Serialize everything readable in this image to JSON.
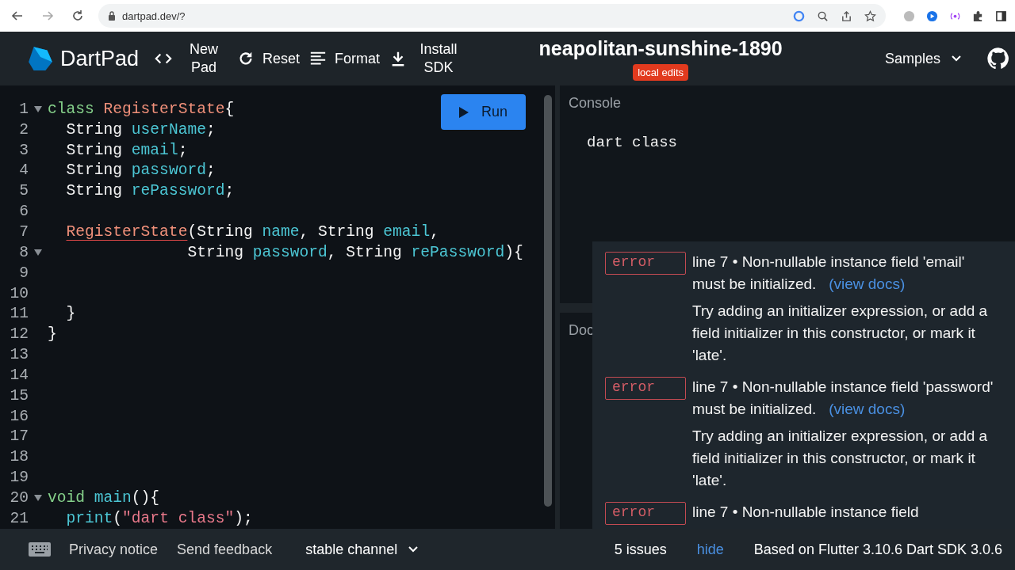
{
  "browser": {
    "url": "dartpad.dev/?"
  },
  "header": {
    "logo": "DartPad",
    "buttons": [
      {
        "kind": "code",
        "label": "New Pad"
      },
      {
        "kind": "refresh",
        "label": "Reset"
      },
      {
        "kind": "format",
        "label": "Format"
      },
      {
        "kind": "download",
        "label": "Install SDK"
      }
    ],
    "title": "neapolitan-sunshine-1890",
    "badge": "local edits",
    "samples": "Samples"
  },
  "editor": {
    "run": "Run",
    "lines": [
      {
        "number": "1",
        "fold": true,
        "tokens": [
          {
            "kind": "keyword",
            "text": "class "
          },
          {
            "kind": "class",
            "text": "RegisterState"
          },
          {
            "kind": "plain",
            "text": "{"
          }
        ]
      },
      {
        "number": "2",
        "fold": false,
        "tokens": [
          {
            "kind": "plain",
            "text": "  String "
          },
          {
            "kind": "ident",
            "text": "userName"
          },
          {
            "kind": "plain",
            "text": ";"
          }
        ]
      },
      {
        "number": "3",
        "fold": false,
        "tokens": [
          {
            "kind": "plain",
            "text": "  String "
          },
          {
            "kind": "ident",
            "text": "email"
          },
          {
            "kind": "plain",
            "text": ";"
          }
        ]
      },
      {
        "number": "4",
        "fold": false,
        "tokens": [
          {
            "kind": "plain",
            "text": "  String "
          },
          {
            "kind": "ident",
            "text": "password"
          },
          {
            "kind": "plain",
            "text": ";"
          }
        ]
      },
      {
        "number": "5",
        "fold": false,
        "tokens": [
          {
            "kind": "plain",
            "text": "  String "
          },
          {
            "kind": "ident",
            "text": "rePassword"
          },
          {
            "kind": "plain",
            "text": ";"
          }
        ]
      },
      {
        "number": "6",
        "fold": false
      },
      {
        "number": "7",
        "fold": false,
        "tokens": [
          {
            "kind": "error",
            "text": "  RegisterState"
          },
          {
            "kind": "plain",
            "text": "(String "
          },
          {
            "kind": "ident",
            "text": "name"
          },
          {
            "kind": "plain",
            "text": ", String "
          },
          {
            "kind": "ident",
            "text": "email"
          },
          {
            "kind": "plain",
            "text": ","
          }
        ]
      },
      {
        "number": "8",
        "fold": true,
        "tokens": [
          {
            "kind": "plain",
            "text": "               String "
          },
          {
            "kind": "ident",
            "text": "password"
          },
          {
            "kind": "plain",
            "text": ", String "
          },
          {
            "kind": "ident",
            "text": "rePassword"
          },
          {
            "kind": "plain",
            "text": "){"
          }
        ]
      },
      {
        "number": "9",
        "fold": false
      },
      {
        "number": "10",
        "fold": false
      },
      {
        "number": "11",
        "fold": false,
        "tokens": [
          {
            "kind": "plain",
            "text": "  }"
          }
        ]
      },
      {
        "number": "12",
        "fold": false,
        "tokens": [
          {
            "kind": "plain",
            "text": "}"
          }
        ]
      },
      {
        "number": "13",
        "fold": false
      },
      {
        "number": "14",
        "fold": false
      },
      {
        "number": "15",
        "fold": false
      },
      {
        "number": "16",
        "fold": false
      },
      {
        "number": "17",
        "fold": false
      },
      {
        "number": "18",
        "fold": false
      },
      {
        "number": "19",
        "fold": false
      },
      {
        "number": "20",
        "fold": true,
        "tokens": [
          {
            "kind": "keyword",
            "text": "void "
          },
          {
            "kind": "ident",
            "text": "main"
          },
          {
            "kind": "plain",
            "text": "(){"
          }
        ]
      },
      {
        "number": "21",
        "fold": false,
        "tokens": [
          {
            "kind": "ident",
            "text": "  print"
          },
          {
            "kind": "plain",
            "text": "("
          },
          {
            "kind": "string",
            "text": "\"dart class\""
          },
          {
            "kind": "plain",
            "text": ");"
          }
        ]
      }
    ]
  },
  "console": {
    "title": "Console",
    "output": "dart class"
  },
  "docs": {
    "title": "Doc"
  },
  "issues": [
    {
      "label": "error",
      "message": "line 7 • Non-nullable instance field 'email' must be initialized.",
      "link": "(view docs)",
      "hint": "Try adding an initializer expression, or add a field initializer in this constructor, or mark it 'late'."
    },
    {
      "label": "error",
      "message": "line 7 • Non-nullable instance field 'password' must be initialized.",
      "link": "(view docs)",
      "hint": "Try adding an initializer expression, or add a field initializer in this constructor, or mark it 'late'."
    },
    {
      "label": "error",
      "message": "line 7 • Non-nullable instance field"
    }
  ],
  "footer": {
    "privacy": "Privacy notice",
    "feedback": "Send feedback",
    "channel": "stable channel",
    "issues": "5 issues",
    "hide": "hide",
    "version": "Based on Flutter 3.10.6 Dart SDK 3.0.6"
  }
}
